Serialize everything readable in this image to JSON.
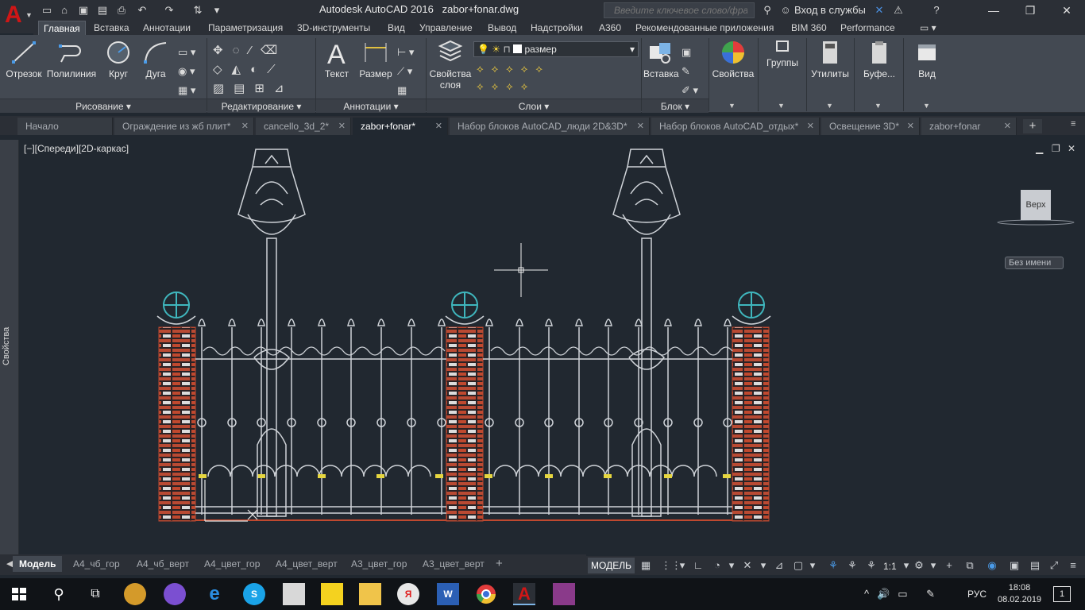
{
  "window": {
    "title_app": "Autodesk AutoCAD 2016",
    "title_file": "zabor+fonar.dwg",
    "search_placeholder": "Введите ключевое слово/фразу",
    "login_label": "Вход в службы"
  },
  "ribbon_tabs": [
    "Главная",
    "Вставка",
    "Аннотации",
    "Параметризация",
    "3D-инструменты",
    "Вид",
    "Управление",
    "Вывод",
    "Надстройки",
    "A360",
    "Рекомендованные приложения",
    "BIM 360",
    "Performance"
  ],
  "ribbon": {
    "draw": {
      "line": "Отрезок",
      "polyline": "Полилиния",
      "circle": "Круг",
      "arc": "Дуга",
      "panel": "Рисование ▾"
    },
    "modify": {
      "panel": "Редактирование ▾"
    },
    "annotation": {
      "text": "Текст",
      "dimension": "Размер",
      "panel": "Аннотации ▾"
    },
    "layers": {
      "props": "Свойства",
      "props2": "слоя",
      "current_layer": "размер",
      "panel": "Слои ▾"
    },
    "block": {
      "insert": "Вставка",
      "panel": "Блок ▾"
    },
    "properties": "Свойства",
    "groups": "Группы",
    "utilities": "Утилиты",
    "clipboard": "Буфе...",
    "view": "Вид"
  },
  "doc_tabs": [
    {
      "label": "Начало"
    },
    {
      "label": "Ограждение из жб плит*"
    },
    {
      "label": "cancello_3d_2*"
    },
    {
      "label": "zabor+fonar*"
    },
    {
      "label": "Набор блоков AutoCAD_люди 2D&3D*"
    },
    {
      "label": "Набор блоков AutoCAD_отдых*"
    },
    {
      "label": "Освещение 3D*"
    },
    {
      "label": "zabor+fonar"
    }
  ],
  "side_panel": {
    "label": "Свойства"
  },
  "viewport": {
    "label": "[−][Спереди][2D-каркас]",
    "viewcube": "Верх",
    "wcs": "Без имени"
  },
  "layout_tabs": [
    "Модель",
    "А4_чб_гор",
    "А4_чб_верт",
    "А4_цвет_гор",
    "А4_цвет_верт",
    "А3_цвет_гор",
    "А3_цвет_верт"
  ],
  "status": {
    "model": "МОДЕЛЬ",
    "scale": "1:1"
  },
  "taskbar": {
    "lang": "РУС",
    "time": "18:08",
    "date": "08.02.2019",
    "notifications": "1"
  },
  "colors": {
    "accent": "#d01616",
    "brick": "#c0492f",
    "teal": "#3fb6bd",
    "metal": "#cfd3d8",
    "background": "#212830"
  },
  "icons": [
    "autocad-logo-icon",
    "new-icon",
    "open-icon",
    "save-icon",
    "print-icon",
    "undo-icon",
    "redo-icon",
    "search-icon",
    "user-icon",
    "help-icon",
    "windows-start-icon"
  ]
}
